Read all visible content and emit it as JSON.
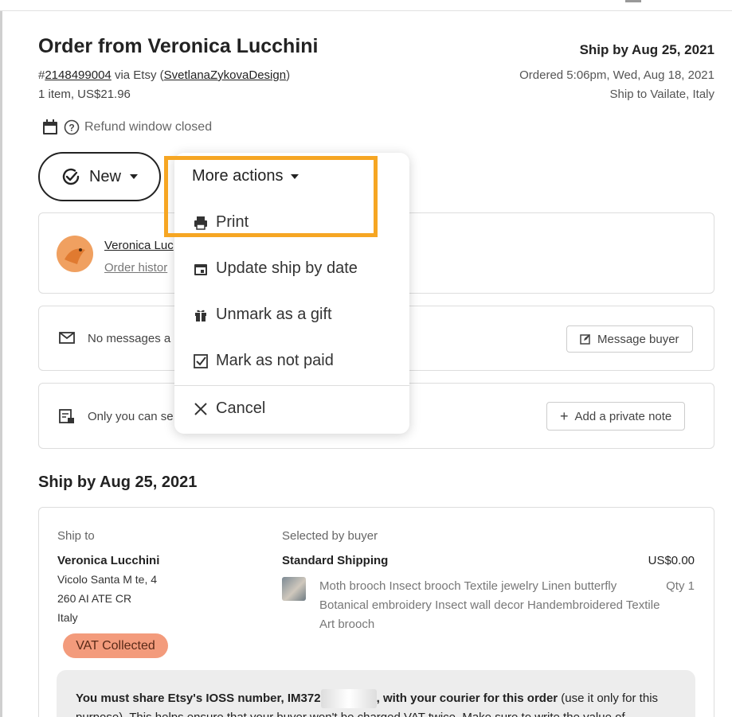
{
  "order": {
    "title": "Order from Veronica Lucchini",
    "hash": "#",
    "number": "2148499004",
    "via": " via Etsy (",
    "shop": "SvetlanaZykovaDesign",
    "close_paren": ")",
    "summary": "1 item,  US$21.96",
    "ship_by": "Ship by Aug 25, 2021",
    "ordered": "Ordered 5:06pm, Wed, Aug 18, 2021",
    "ship_to": "Ship to Vailate, Italy",
    "refund": "Refund window closed"
  },
  "status_button": {
    "label": "New"
  },
  "buyer": {
    "name": "Veronica Luc",
    "history": "Order histor"
  },
  "messages": {
    "text": "No messages a",
    "button": "Message buyer"
  },
  "notes": {
    "text": "Only you can se",
    "button": "Add a private note"
  },
  "menu": {
    "title": "More actions",
    "items": [
      {
        "label": "Print",
        "icon": "printer-icon"
      },
      {
        "label": "Update ship by date",
        "icon": "calendar-icon"
      },
      {
        "label": "Unmark as a gift",
        "icon": "gift-icon"
      },
      {
        "label": "Mark as not paid",
        "icon": "checkbox-icon"
      },
      {
        "label": "Cancel",
        "icon": "close-icon"
      }
    ]
  },
  "shipping": {
    "section_title": "Ship by Aug 25, 2021",
    "ship_to_label": "Ship to",
    "recipient": "Veronica Lucchini",
    "address_line1": "Vicolo Santa M  te, 4",
    "address_line2": "260    AI ATE CR",
    "country": "Italy",
    "vat_badge": "VAT Collected",
    "selected_label": "Selected by buyer",
    "method": "Standard Shipping",
    "price": "US$0.00",
    "item_title": "Moth brooch Insect brooch Textile jewelry Linen butterfly Botanical embroidery Insect wall decor Handembroidered Textile Art brooch",
    "qty": "Qty 1"
  },
  "notice": {
    "bold": "You must share Etsy's IOSS number, IM372",
    "bold_end": ", with your courier for this order",
    "rest": " (use it only for this purpose). This helps ensure that your buyer won't be charged VAT twice. Make sure to write the value of"
  },
  "colors": {
    "highlight": "#f6a623",
    "vat_badge": "#f39b7c"
  }
}
